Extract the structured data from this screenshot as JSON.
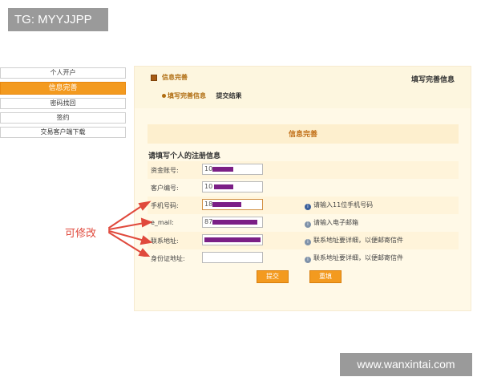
{
  "watermark": {
    "tg": "TG: MYYJJPP",
    "site": "www.wanxintai.com"
  },
  "sidebar": {
    "items": [
      {
        "label": "个人开户",
        "active": false
      },
      {
        "label": "信息完善",
        "active": true
      },
      {
        "label": "密码找回",
        "active": false
      },
      {
        "label": "签约",
        "active": false
      },
      {
        "label": "交易客户端下载",
        "active": false
      }
    ]
  },
  "header": {
    "title": "信息完善",
    "right_title": "填写完善信息"
  },
  "steps": {
    "current": "填写完善信息",
    "next": "提交结果"
  },
  "form": {
    "section_title": "信息完善",
    "intro": "请填写个人的注册信息",
    "rows": [
      {
        "label": "资金账号:",
        "value": "10",
        "hint": ""
      },
      {
        "label": "客户编号:",
        "value": "10",
        "hint": ""
      },
      {
        "label": "手机号码:",
        "value": "18",
        "hint": "请输入11位手机号码"
      },
      {
        "label": "e_mail:",
        "value": "87",
        "hint": "请输入电子邮箱"
      },
      {
        "label": "联系地址:",
        "value": "",
        "hint": "联系地址要详细，以便邮寄信件"
      },
      {
        "label": "身份证地址:",
        "value": "",
        "hint": "联系地址要详细，以便邮寄信件"
      }
    ],
    "submit_label": "提交",
    "reset_label": "重填"
  },
  "annotation": {
    "text": "可修改",
    "color": "#e0493c"
  },
  "colors": {
    "accent": "#f39a1f",
    "title": "#b06d12",
    "redaction": "#7b1f86"
  },
  "icons": {
    "hint_info": "info-icon",
    "hint_tip": "tip-icon",
    "header": "square-icon"
  }
}
